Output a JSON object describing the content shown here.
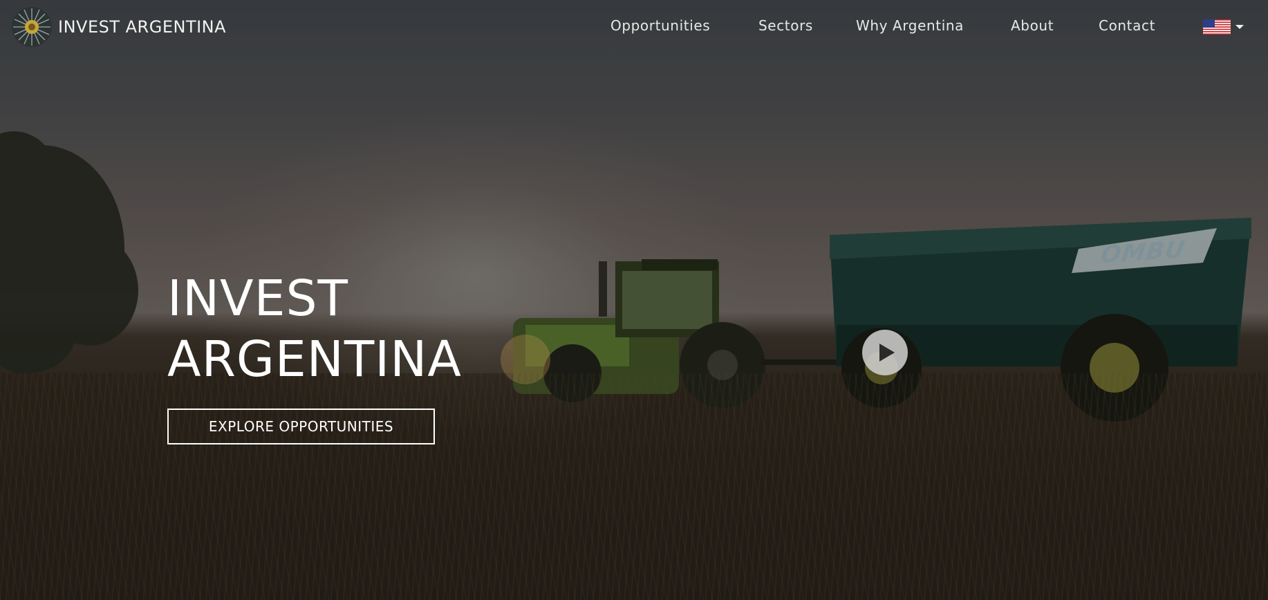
{
  "header": {
    "brand_name": "INVEST ARGENTINA",
    "logo_icon": "sunburst-logo-icon",
    "nav": [
      {
        "label": "Opportunities"
      },
      {
        "label": "Sectors"
      },
      {
        "label": "Why Argentina"
      },
      {
        "label": "About"
      },
      {
        "label": "Contact"
      }
    ],
    "language": {
      "selected_icon": "us-flag-icon",
      "dropdown_icon": "caret-down-icon"
    }
  },
  "hero": {
    "title_line1": "INVEST",
    "title_line2": "ARGENTINA",
    "cta_label": "EXPLORE OPPORTUNITIES",
    "play_icon": "play-icon",
    "background_description_text": "OMBU"
  },
  "colors": {
    "text": "#ffffff",
    "nav_text": "#e8e8e8",
    "play_button": "#d2d2d2",
    "tractor_green": "#4e6b2e",
    "trailer_teal": "#1e4a44"
  }
}
